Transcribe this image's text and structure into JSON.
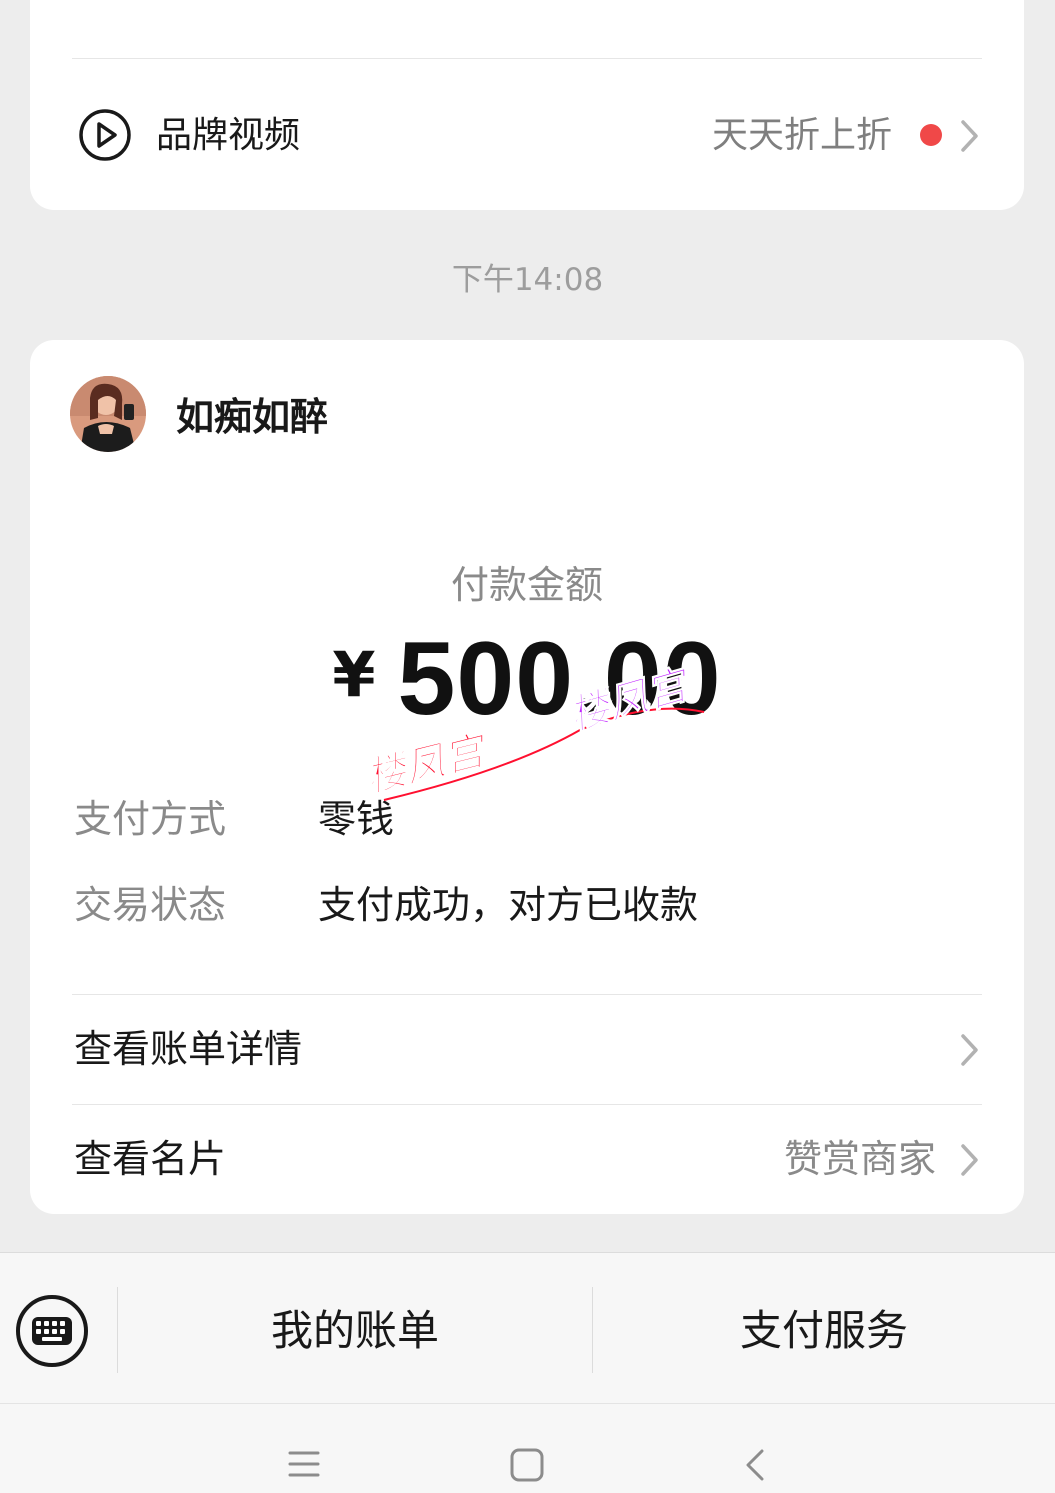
{
  "top_card": {
    "brand_label": "品牌视频",
    "brand_tag": "天天折上折",
    "icon": "play-circle-icon",
    "dot_color": "#f04848"
  },
  "timestamp": "下午14:08",
  "payment": {
    "payee_name": "如痴如醉",
    "amount_label": "付款金额",
    "currency": "¥",
    "amount": "500.00",
    "method_label": "支付方式",
    "method_value": "零钱",
    "status_label": "交易状态",
    "status_value": "支付成功，对方已收款",
    "bill_detail_link": "查看账单详情",
    "card_link": "查看名片",
    "card_link_extra": "赞赏商家"
  },
  "watermark": {
    "text": "楼凤宫",
    "color_red": "#ff1030",
    "color_purple": "#c020ff"
  },
  "bottom_bar": {
    "keyboard_icon": "keyboard-icon",
    "my_bill": "我的账单",
    "pay_service": "支付服务"
  },
  "nav": {
    "menu_icon": "menu-icon",
    "home_icon": "home-icon",
    "back_icon": "back-icon"
  }
}
